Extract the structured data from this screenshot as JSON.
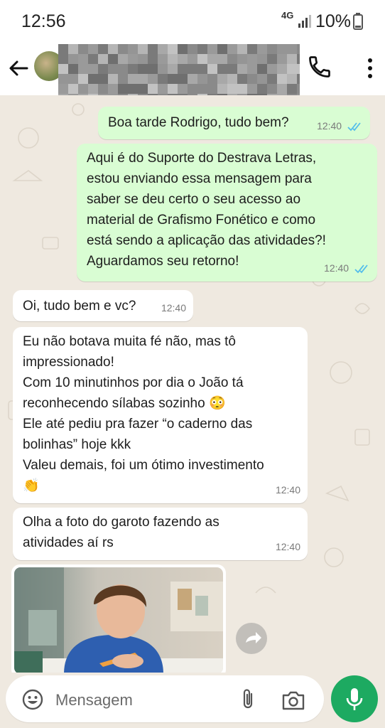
{
  "status_bar": {
    "time": "12:56",
    "network": "4G",
    "battery": "10%"
  },
  "header": {
    "contact_name": "",
    "icons": [
      "back-arrow-icon",
      "avatar",
      "phone-icon",
      "more-vert-icon"
    ]
  },
  "messages": [
    {
      "direction": "out",
      "text": "Boa tarde Rodrigo, tudo bem?",
      "time": "12:40",
      "read": true
    },
    {
      "direction": "out",
      "text": "Aqui é do Suporte do Destrava Letras,\nestou enviando essa mensagem para\nsaber se deu certo o seu acesso ao\nmaterial de Grafismo Fonético e como\nestá sendo a aplicação das atividades?!\nAguardamos seu retorno!",
      "time": "12:40",
      "read": true
    },
    {
      "direction": "in",
      "text": "Oi, tudo bem e vc?",
      "time": "12:40"
    },
    {
      "direction": "in",
      "text": "Eu não botava muita fé não, mas tô\nimpressionado!\nCom 10 minutinhos por dia o João tá\nreconhecendo sílabas sozinho 😳\nEle até pediu pra fazer “o caderno das\nbolinhas” hoje kkk\nValeu demais, foi um ótimo investimento\n👏",
      "time": "12:40"
    },
    {
      "direction": "in",
      "text": "Olha a foto do garoto fazendo as\natividades aí rs",
      "time": "12:40"
    }
  ],
  "composer": {
    "placeholder": "Mensagem"
  },
  "colors": {
    "outgoing_bubble": "#d9fdd3",
    "incoming_bubble": "#ffffff",
    "read_ticks": "#53bdeb",
    "mic_button": "#1daa61"
  }
}
